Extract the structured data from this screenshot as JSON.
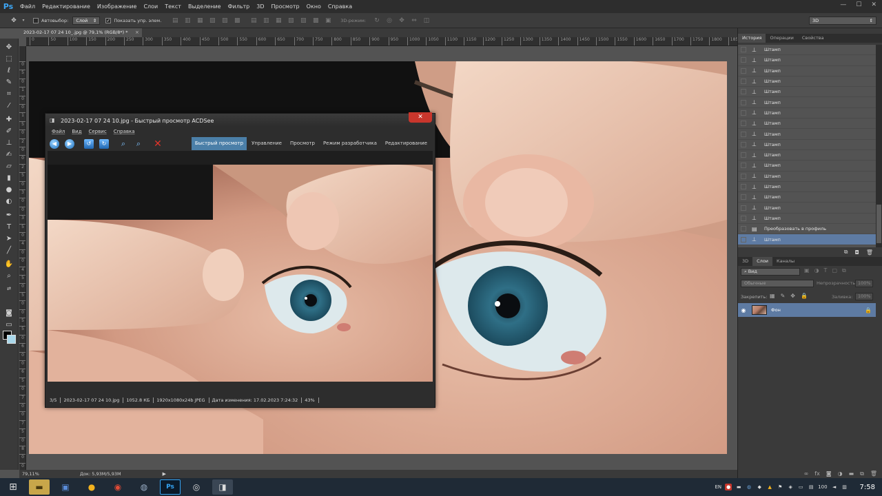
{
  "app": {
    "logo": "Ps",
    "menu": [
      "Файл",
      "Редактирование",
      "Изображение",
      "Слои",
      "Текст",
      "Выделение",
      "Фильтр",
      "3D",
      "Просмотр",
      "Окно",
      "Справка"
    ],
    "window_controls": [
      "—",
      "☐",
      "✕"
    ]
  },
  "options_bar": {
    "autoselect_label": "Автовыбор:",
    "autoselect_value": "Слой",
    "show_controls_label": "Показать упр. элем.",
    "mode_3d_label": "3D-режим:",
    "workspace": "3D"
  },
  "document": {
    "tab_title": "2023-02-17 07 24 10_.jpg @ 79,1% (RGB/8*) *",
    "close": "×"
  },
  "ruler": {
    "top": [
      "0",
      "50",
      "100",
      "150",
      "200",
      "250",
      "300",
      "350",
      "400",
      "450",
      "500",
      "550",
      "600",
      "650",
      "700",
      "750",
      "800",
      "850",
      "900",
      "950",
      "1000",
      "1050",
      "1100",
      "1150",
      "1200",
      "1250",
      "1300",
      "1350",
      "1400",
      "1450",
      "1500",
      "1550",
      "1600",
      "1650",
      "1700",
      "1750",
      "1800",
      "1850",
      "1900"
    ],
    "left": [
      "0",
      "5",
      "0",
      "1",
      "0",
      "0",
      "1",
      "5",
      "0",
      "2",
      "0",
      "0",
      "2",
      "5",
      "0",
      "3",
      "0",
      "0",
      "3",
      "5",
      "0",
      "4",
      "0",
      "0",
      "4",
      "5",
      "0",
      "5",
      "0",
      "0",
      "5",
      "5",
      "0",
      "6",
      "0",
      "0",
      "6",
      "5",
      "0",
      "7",
      "0",
      "0",
      "7",
      "5",
      "0",
      "8",
      "0",
      "0"
    ]
  },
  "status": {
    "zoom": "79,11%",
    "doc_size": "Док: 5,93М/5,93М",
    "arrow": "▶"
  },
  "history_panel": {
    "tabs": [
      "История",
      "Операции",
      "Свойства"
    ],
    "items": [
      "Штамп",
      "Штамп",
      "Штамп",
      "Штамп",
      "Штамп",
      "Штамп",
      "Штамп",
      "Штамп",
      "Штамп",
      "Штамп",
      "Штамп",
      "Штамп",
      "Штамп",
      "Штамп",
      "Штамп",
      "Штамп",
      "Штамп",
      "Преобразовать в профиль",
      "Штамп"
    ],
    "selected_index": 18
  },
  "layers_panel": {
    "tabs": [
      "3D",
      "Слои",
      "Каналы"
    ],
    "filter": "Вид",
    "blend_mode": "Обычные",
    "opacity_label": "Непрозрачность:",
    "opacity_value": "100%",
    "lock_label": "Закрепить:",
    "fill_label": "Заливка:",
    "fill_value": "100%",
    "layer_name": "Фон"
  },
  "acdsee": {
    "title": "2023-02-17 07 24 10.jpg - Быстрый просмотр ACDSee",
    "menu": [
      "Файл",
      "Вид",
      "Сервис",
      "Справка"
    ],
    "modes": [
      "Быстрый просмотр",
      "Управление",
      "Просмотр",
      "Режим разработчика",
      "Редактирование"
    ],
    "active_mode_index": 0,
    "status": [
      "3/5",
      "2023-02-17 07 24 10.jpg",
      "1052.8 КБ",
      "1920x1080x24b JPEG",
      "Дата изменения: 17.02.2023 7:24:32",
      "43%"
    ]
  },
  "taskbar": {
    "lang": "EN",
    "time": "7:58",
    "battery": "100"
  },
  "colors": {
    "accent_selection": "#5e7ba3",
    "acdsee_active_mode": "#4b7fa8",
    "acdsee_close": "#c8362c",
    "foreground_color": "#000000",
    "background_color": "#a9d7ea"
  }
}
